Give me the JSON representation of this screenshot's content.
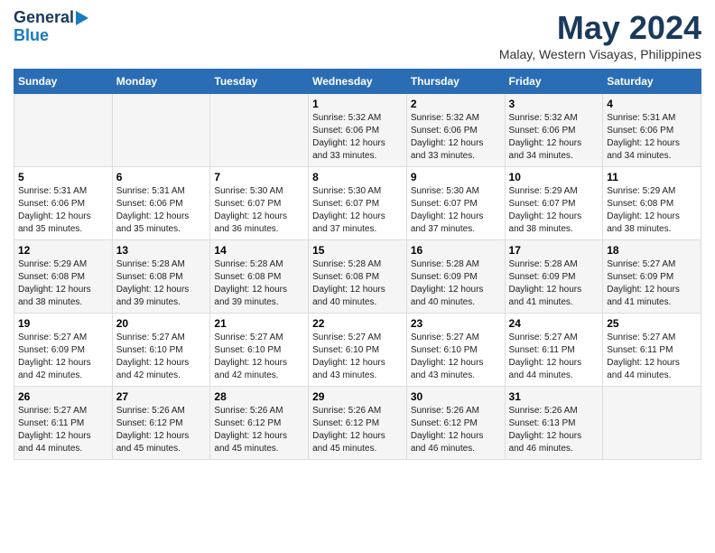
{
  "logo": {
    "line1": "General",
    "line2": "Blue"
  },
  "title": "May 2024",
  "subtitle": "Malay, Western Visayas, Philippines",
  "days_of_week": [
    "Sunday",
    "Monday",
    "Tuesday",
    "Wednesday",
    "Thursday",
    "Friday",
    "Saturday"
  ],
  "weeks": [
    {
      "cells": [
        {
          "day": "",
          "info": ""
        },
        {
          "day": "",
          "info": ""
        },
        {
          "day": "",
          "info": ""
        },
        {
          "day": "1",
          "info": "Sunrise: 5:32 AM\nSunset: 6:06 PM\nDaylight: 12 hours\nand 33 minutes."
        },
        {
          "day": "2",
          "info": "Sunrise: 5:32 AM\nSunset: 6:06 PM\nDaylight: 12 hours\nand 33 minutes."
        },
        {
          "day": "3",
          "info": "Sunrise: 5:32 AM\nSunset: 6:06 PM\nDaylight: 12 hours\nand 34 minutes."
        },
        {
          "day": "4",
          "info": "Sunrise: 5:31 AM\nSunset: 6:06 PM\nDaylight: 12 hours\nand 34 minutes."
        }
      ]
    },
    {
      "cells": [
        {
          "day": "5",
          "info": "Sunrise: 5:31 AM\nSunset: 6:06 PM\nDaylight: 12 hours\nand 35 minutes."
        },
        {
          "day": "6",
          "info": "Sunrise: 5:31 AM\nSunset: 6:06 PM\nDaylight: 12 hours\nand 35 minutes."
        },
        {
          "day": "7",
          "info": "Sunrise: 5:30 AM\nSunset: 6:07 PM\nDaylight: 12 hours\nand 36 minutes."
        },
        {
          "day": "8",
          "info": "Sunrise: 5:30 AM\nSunset: 6:07 PM\nDaylight: 12 hours\nand 37 minutes."
        },
        {
          "day": "9",
          "info": "Sunrise: 5:30 AM\nSunset: 6:07 PM\nDaylight: 12 hours\nand 37 minutes."
        },
        {
          "day": "10",
          "info": "Sunrise: 5:29 AM\nSunset: 6:07 PM\nDaylight: 12 hours\nand 38 minutes."
        },
        {
          "day": "11",
          "info": "Sunrise: 5:29 AM\nSunset: 6:08 PM\nDaylight: 12 hours\nand 38 minutes."
        }
      ]
    },
    {
      "cells": [
        {
          "day": "12",
          "info": "Sunrise: 5:29 AM\nSunset: 6:08 PM\nDaylight: 12 hours\nand 38 minutes."
        },
        {
          "day": "13",
          "info": "Sunrise: 5:28 AM\nSunset: 6:08 PM\nDaylight: 12 hours\nand 39 minutes."
        },
        {
          "day": "14",
          "info": "Sunrise: 5:28 AM\nSunset: 6:08 PM\nDaylight: 12 hours\nand 39 minutes."
        },
        {
          "day": "15",
          "info": "Sunrise: 5:28 AM\nSunset: 6:08 PM\nDaylight: 12 hours\nand 40 minutes."
        },
        {
          "day": "16",
          "info": "Sunrise: 5:28 AM\nSunset: 6:09 PM\nDaylight: 12 hours\nand 40 minutes."
        },
        {
          "day": "17",
          "info": "Sunrise: 5:28 AM\nSunset: 6:09 PM\nDaylight: 12 hours\nand 41 minutes."
        },
        {
          "day": "18",
          "info": "Sunrise: 5:27 AM\nSunset: 6:09 PM\nDaylight: 12 hours\nand 41 minutes."
        }
      ]
    },
    {
      "cells": [
        {
          "day": "19",
          "info": "Sunrise: 5:27 AM\nSunset: 6:09 PM\nDaylight: 12 hours\nand 42 minutes."
        },
        {
          "day": "20",
          "info": "Sunrise: 5:27 AM\nSunset: 6:10 PM\nDaylight: 12 hours\nand 42 minutes."
        },
        {
          "day": "21",
          "info": "Sunrise: 5:27 AM\nSunset: 6:10 PM\nDaylight: 12 hours\nand 42 minutes."
        },
        {
          "day": "22",
          "info": "Sunrise: 5:27 AM\nSunset: 6:10 PM\nDaylight: 12 hours\nand 43 minutes."
        },
        {
          "day": "23",
          "info": "Sunrise: 5:27 AM\nSunset: 6:10 PM\nDaylight: 12 hours\nand 43 minutes."
        },
        {
          "day": "24",
          "info": "Sunrise: 5:27 AM\nSunset: 6:11 PM\nDaylight: 12 hours\nand 44 minutes."
        },
        {
          "day": "25",
          "info": "Sunrise: 5:27 AM\nSunset: 6:11 PM\nDaylight: 12 hours\nand 44 minutes."
        }
      ]
    },
    {
      "cells": [
        {
          "day": "26",
          "info": "Sunrise: 5:27 AM\nSunset: 6:11 PM\nDaylight: 12 hours\nand 44 minutes."
        },
        {
          "day": "27",
          "info": "Sunrise: 5:26 AM\nSunset: 6:12 PM\nDaylight: 12 hours\nand 45 minutes."
        },
        {
          "day": "28",
          "info": "Sunrise: 5:26 AM\nSunset: 6:12 PM\nDaylight: 12 hours\nand 45 minutes."
        },
        {
          "day": "29",
          "info": "Sunrise: 5:26 AM\nSunset: 6:12 PM\nDaylight: 12 hours\nand 45 minutes."
        },
        {
          "day": "30",
          "info": "Sunrise: 5:26 AM\nSunset: 6:12 PM\nDaylight: 12 hours\nand 46 minutes."
        },
        {
          "day": "31",
          "info": "Sunrise: 5:26 AM\nSunset: 6:13 PM\nDaylight: 12 hours\nand 46 minutes."
        },
        {
          "day": "",
          "info": ""
        }
      ]
    }
  ]
}
